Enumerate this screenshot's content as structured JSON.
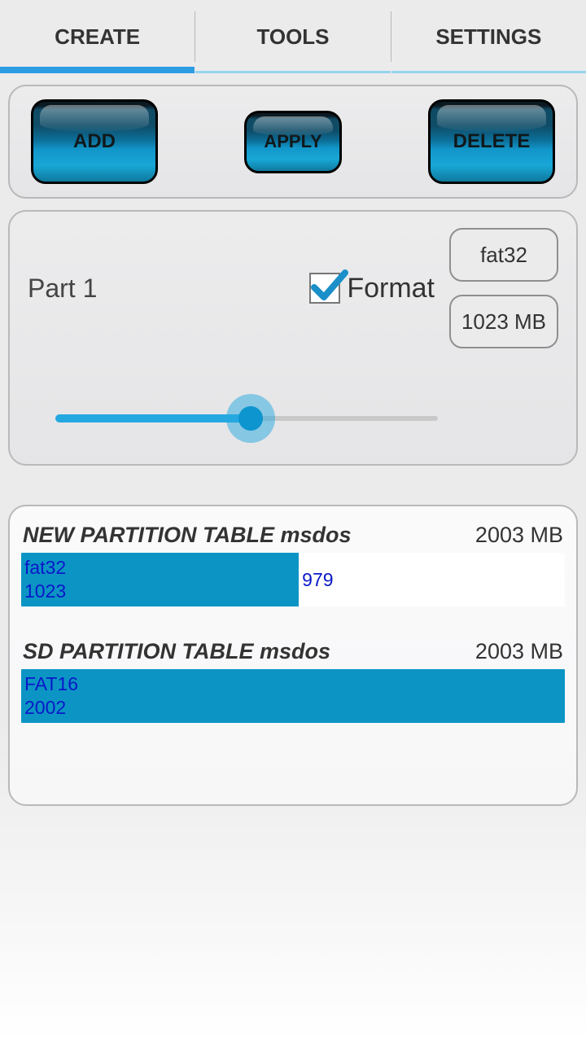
{
  "tabs": {
    "create": "CREATE",
    "tools": "TOOLS",
    "settings": "SETTINGS",
    "active": "create"
  },
  "buttons": {
    "add": "ADD",
    "apply": "APPLY",
    "delete": "DELETE"
  },
  "part": {
    "title": "Part 1",
    "format_label": "Format",
    "format_checked": true,
    "fs": "fat32",
    "size_label": "1023 MB",
    "slider_min": 0,
    "slider_max": 2003,
    "slider_value": 1023
  },
  "tables": {
    "new": {
      "title": "NEW PARTITION TABLE msdos",
      "total": "2003 MB",
      "segments": [
        {
          "fs": "fat32",
          "size": "1023",
          "color": "blue",
          "ratio": 0.511
        },
        {
          "fs": "",
          "size": "979",
          "color": "white",
          "ratio": 0.489
        }
      ]
    },
    "sd": {
      "title": "SD PARTITION TABLE msdos",
      "total": "2003 MB",
      "segments": [
        {
          "fs": "FAT16",
          "size": "2002",
          "color": "blue",
          "ratio": 1.0
        }
      ]
    }
  }
}
